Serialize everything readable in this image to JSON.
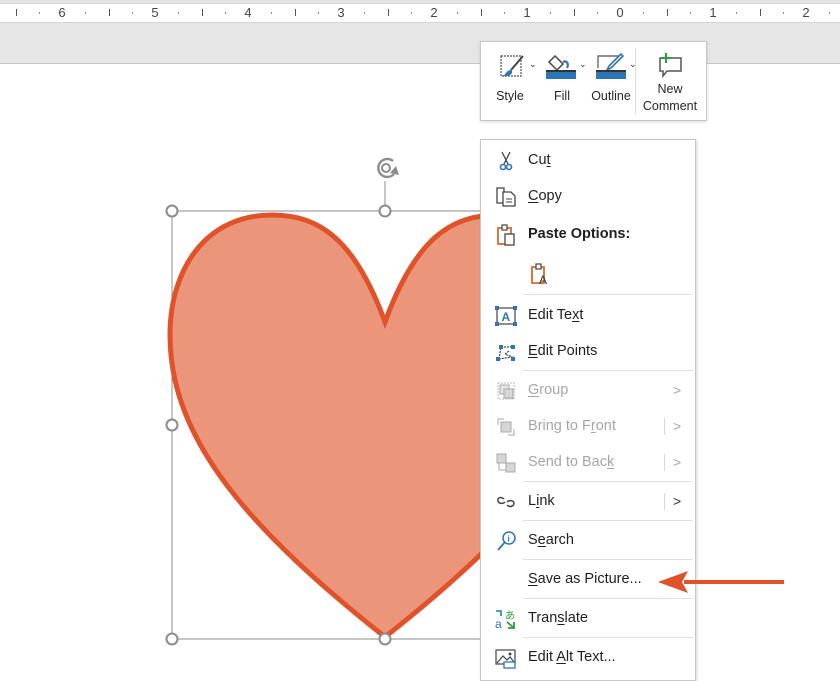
{
  "ruler": {
    "labels": [
      "6",
      "5",
      "4",
      "3",
      "2",
      "1",
      "0",
      "1",
      "2"
    ]
  },
  "colors": {
    "shape_fill": "#eb967a",
    "shape_outline": "#e0522a",
    "selection": "#8c8c8c",
    "arrow": "#e0522a",
    "accent_blue": "#2e75b6",
    "disabled_text": "#a6a6a6"
  },
  "shape": {
    "type": "heart",
    "selected": true
  },
  "mini_toolbar": {
    "style_label": "Style",
    "fill_label": "Fill",
    "outline_label": "Outline",
    "new_comment_line1": "New",
    "new_comment_line2": "Comment"
  },
  "context_menu": {
    "items": [
      {
        "label_pre": "Cu",
        "accel": "t",
        "label_post": "",
        "icon": "scissors-icon",
        "enabled": true
      },
      {
        "label_pre": "",
        "accel": "C",
        "label_post": "opy",
        "icon": "copy-icon",
        "enabled": true
      },
      {
        "label_pre": "Paste Options:",
        "accel": "",
        "label_post": "",
        "icon": "paste-icon",
        "enabled": true,
        "bold": true
      },
      {
        "label_pre": "",
        "accel": "",
        "label_post": "",
        "icon": "paste-text-only-icon",
        "enabled": true
      },
      {
        "label_pre": "Edit Te",
        "accel": "x",
        "label_post": "t",
        "icon": "edit-text-icon",
        "enabled": true
      },
      {
        "label_pre": "",
        "accel": "E",
        "label_post": "dit Points",
        "icon": "edit-points-icon",
        "enabled": true
      },
      {
        "label_pre": "",
        "accel": "G",
        "label_post": "roup",
        "icon": "group-icon",
        "enabled": false,
        "submenu": true
      },
      {
        "label_pre": "Bring to F",
        "accel": "r",
        "label_post": "ont",
        "icon": "bring-to-front-icon",
        "enabled": false,
        "submenu": true,
        "split": true
      },
      {
        "label_pre": "Send to Bac",
        "accel": "k",
        "label_post": "",
        "icon": "send-to-back-icon",
        "enabled": false,
        "submenu": true,
        "split": true
      },
      {
        "label_pre": "L",
        "accel": "i",
        "label_post": "nk",
        "icon": "link-icon",
        "enabled": true,
        "submenu": true,
        "split": true
      },
      {
        "label_pre": "S",
        "accel": "e",
        "label_post": "arch",
        "icon": "search-icon",
        "enabled": true
      },
      {
        "label_pre": "",
        "accel": "S",
        "label_post": "ave as Picture...",
        "icon": "",
        "enabled": true
      },
      {
        "label_pre": "Tran",
        "accel": "s",
        "label_post": "late",
        "icon": "translate-icon",
        "enabled": true
      },
      {
        "label_pre": "Edit ",
        "accel": "A",
        "label_post": "lt Text...",
        "icon": "alt-text-icon",
        "enabled": true
      }
    ],
    "submenu_glyph": ">"
  },
  "annotation": {
    "type": "arrow",
    "points_to": "Save as Picture..."
  }
}
